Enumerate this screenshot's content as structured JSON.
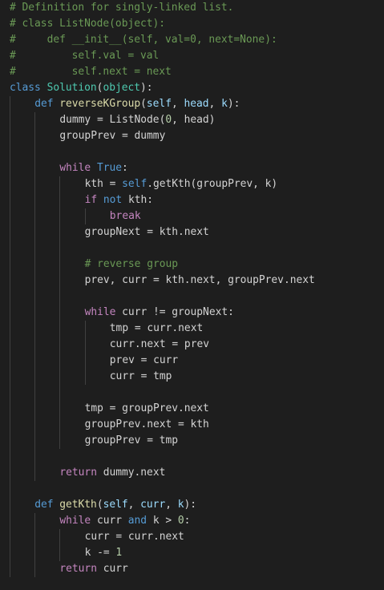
{
  "theme": {
    "background": "#1e1e1e",
    "colors": {
      "text": "#d4d4d4",
      "comment": "#6a9955",
      "kw": "#569cd6",
      "ctrl": "#c586c0",
      "cls": "#4ec9b0",
      "fn": "#dcdcaa",
      "param": "#9cdcfe",
      "num": "#b5cea8",
      "guide": "#404040"
    }
  },
  "code_lines": [
    {
      "indent": 0,
      "tokens": [
        {
          "t": "comment",
          "v": "# Definition for singly-linked list."
        }
      ]
    },
    {
      "indent": 0,
      "tokens": [
        {
          "t": "comment",
          "v": "# class ListNode(object):"
        }
      ]
    },
    {
      "indent": 0,
      "tokens": [
        {
          "t": "comment",
          "v": "#     def __init__(self, val=0, next=None):"
        }
      ]
    },
    {
      "indent": 0,
      "tokens": [
        {
          "t": "comment",
          "v": "#         self.val = val"
        }
      ]
    },
    {
      "indent": 0,
      "tokens": [
        {
          "t": "comment",
          "v": "#         self.next = next"
        }
      ]
    },
    {
      "indent": 0,
      "tokens": [
        {
          "t": "kw",
          "v": "class "
        },
        {
          "t": "cls",
          "v": "Solution"
        },
        {
          "t": "text",
          "v": "("
        },
        {
          "t": "cls",
          "v": "object"
        },
        {
          "t": "text",
          "v": "):"
        }
      ]
    },
    {
      "indent": 1,
      "tokens": [
        {
          "t": "kw",
          "v": "def "
        },
        {
          "t": "fn",
          "v": "reverseKGroup"
        },
        {
          "t": "text",
          "v": "("
        },
        {
          "t": "param",
          "v": "self"
        },
        {
          "t": "text",
          "v": ", "
        },
        {
          "t": "param",
          "v": "head"
        },
        {
          "t": "text",
          "v": ", "
        },
        {
          "t": "param",
          "v": "k"
        },
        {
          "t": "text",
          "v": "):"
        }
      ]
    },
    {
      "indent": 2,
      "tokens": [
        {
          "t": "text",
          "v": "dummy = ListNode("
        },
        {
          "t": "num",
          "v": "0"
        },
        {
          "t": "text",
          "v": ", head)"
        }
      ]
    },
    {
      "indent": 2,
      "tokens": [
        {
          "t": "text",
          "v": "groupPrev = dummy"
        }
      ]
    },
    {
      "indent": 2,
      "tokens": []
    },
    {
      "indent": 2,
      "tokens": [
        {
          "t": "ctrl",
          "v": "while "
        },
        {
          "t": "kw",
          "v": "True"
        },
        {
          "t": "text",
          "v": ":"
        }
      ]
    },
    {
      "indent": 3,
      "tokens": [
        {
          "t": "text",
          "v": "kth = "
        },
        {
          "t": "kw",
          "v": "self"
        },
        {
          "t": "text",
          "v": ".getKth(groupPrev, k)"
        }
      ]
    },
    {
      "indent": 3,
      "tokens": [
        {
          "t": "ctrl",
          "v": "if "
        },
        {
          "t": "kw",
          "v": "not"
        },
        {
          "t": "text",
          "v": " kth:"
        }
      ]
    },
    {
      "indent": 4,
      "tokens": [
        {
          "t": "ctrl",
          "v": "break"
        }
      ]
    },
    {
      "indent": 3,
      "tokens": [
        {
          "t": "text",
          "v": "groupNext = kth.next"
        }
      ]
    },
    {
      "indent": 3,
      "tokens": []
    },
    {
      "indent": 3,
      "tokens": [
        {
          "t": "comment",
          "v": "# reverse group"
        }
      ]
    },
    {
      "indent": 3,
      "tokens": [
        {
          "t": "text",
          "v": "prev, curr = kth.next, groupPrev.next"
        }
      ]
    },
    {
      "indent": 3,
      "tokens": []
    },
    {
      "indent": 3,
      "tokens": [
        {
          "t": "ctrl",
          "v": "while"
        },
        {
          "t": "text",
          "v": " curr != groupNext:"
        }
      ]
    },
    {
      "indent": 4,
      "tokens": [
        {
          "t": "text",
          "v": "tmp = curr.next"
        }
      ]
    },
    {
      "indent": 4,
      "tokens": [
        {
          "t": "text",
          "v": "curr.next = prev"
        }
      ]
    },
    {
      "indent": 4,
      "tokens": [
        {
          "t": "text",
          "v": "prev = curr"
        }
      ]
    },
    {
      "indent": 4,
      "tokens": [
        {
          "t": "text",
          "v": "curr = tmp"
        }
      ]
    },
    {
      "indent": 3,
      "tokens": []
    },
    {
      "indent": 3,
      "tokens": [
        {
          "t": "text",
          "v": "tmp = groupPrev.next"
        }
      ]
    },
    {
      "indent": 3,
      "tokens": [
        {
          "t": "text",
          "v": "groupPrev.next = kth"
        }
      ]
    },
    {
      "indent": 3,
      "tokens": [
        {
          "t": "text",
          "v": "groupPrev = tmp"
        }
      ]
    },
    {
      "indent": 2,
      "tokens": []
    },
    {
      "indent": 2,
      "tokens": [
        {
          "t": "ctrl",
          "v": "return"
        },
        {
          "t": "text",
          "v": " dummy.next"
        }
      ]
    },
    {
      "indent": 1,
      "tokens": []
    },
    {
      "indent": 1,
      "tokens": [
        {
          "t": "kw",
          "v": "def "
        },
        {
          "t": "fn",
          "v": "getKth"
        },
        {
          "t": "text",
          "v": "("
        },
        {
          "t": "param",
          "v": "self"
        },
        {
          "t": "text",
          "v": ", "
        },
        {
          "t": "param",
          "v": "curr"
        },
        {
          "t": "text",
          "v": ", "
        },
        {
          "t": "param",
          "v": "k"
        },
        {
          "t": "text",
          "v": "):"
        }
      ]
    },
    {
      "indent": 2,
      "tokens": [
        {
          "t": "ctrl",
          "v": "while"
        },
        {
          "t": "text",
          "v": " curr "
        },
        {
          "t": "kw",
          "v": "and"
        },
        {
          "t": "text",
          "v": " k > "
        },
        {
          "t": "num",
          "v": "0"
        },
        {
          "t": "text",
          "v": ":"
        }
      ]
    },
    {
      "indent": 3,
      "tokens": [
        {
          "t": "text",
          "v": "curr = curr.next"
        }
      ]
    },
    {
      "indent": 3,
      "tokens": [
        {
          "t": "text",
          "v": "k -= "
        },
        {
          "t": "num",
          "v": "1"
        }
      ]
    },
    {
      "indent": 2,
      "tokens": [
        {
          "t": "ctrl",
          "v": "return"
        },
        {
          "t": "text",
          "v": " curr"
        }
      ]
    }
  ]
}
